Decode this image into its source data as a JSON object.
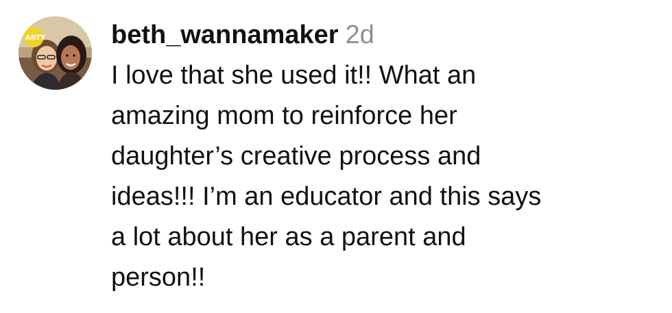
{
  "comment": {
    "username": "beth_wannamaker",
    "timestamp": "2d",
    "avatar": {
      "icon": "user-avatar-photo",
      "logo_text": "ARTY"
    },
    "text_lines": [
      "I love that she used it!! What an",
      "amazing mom to reinforce her",
      "daughter’s creative process and",
      "ideas!!! I’m an educator and this says",
      "a lot about her as a parent and",
      "person!!"
    ]
  },
  "colors": {
    "text": "#111111",
    "timestamp": "#8e8e8e",
    "background": "#ffffff"
  }
}
